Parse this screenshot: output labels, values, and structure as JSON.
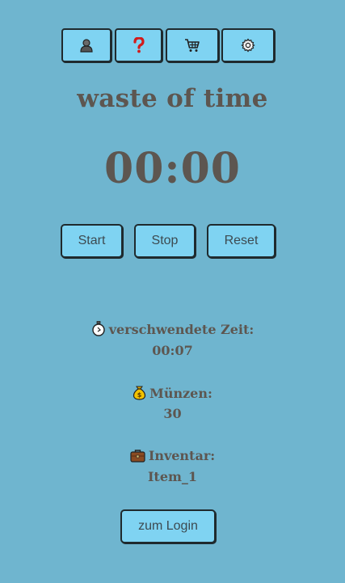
{
  "toolbar": {
    "buttons": [
      {
        "icon": "profile-icon"
      },
      {
        "icon": "help-icon"
      },
      {
        "icon": "shop-cart-icon"
      },
      {
        "icon": "settings-gear-icon"
      }
    ]
  },
  "title": "waste of time",
  "timer": "00:00",
  "controls": {
    "start": "Start",
    "stop": "Stop",
    "reset": "Reset"
  },
  "stats": {
    "wasted_label": "verschwendete Zeit:",
    "wasted_value": "00:07",
    "coins_label": "Münzen:",
    "coins_value": "30",
    "inventory_label": "Inventar:",
    "inventory_value": "Item_1"
  },
  "login_button": "zum Login",
  "colors": {
    "background": "#6fb5cf",
    "button": "#7fd3f2",
    "text": "#5d5650"
  }
}
